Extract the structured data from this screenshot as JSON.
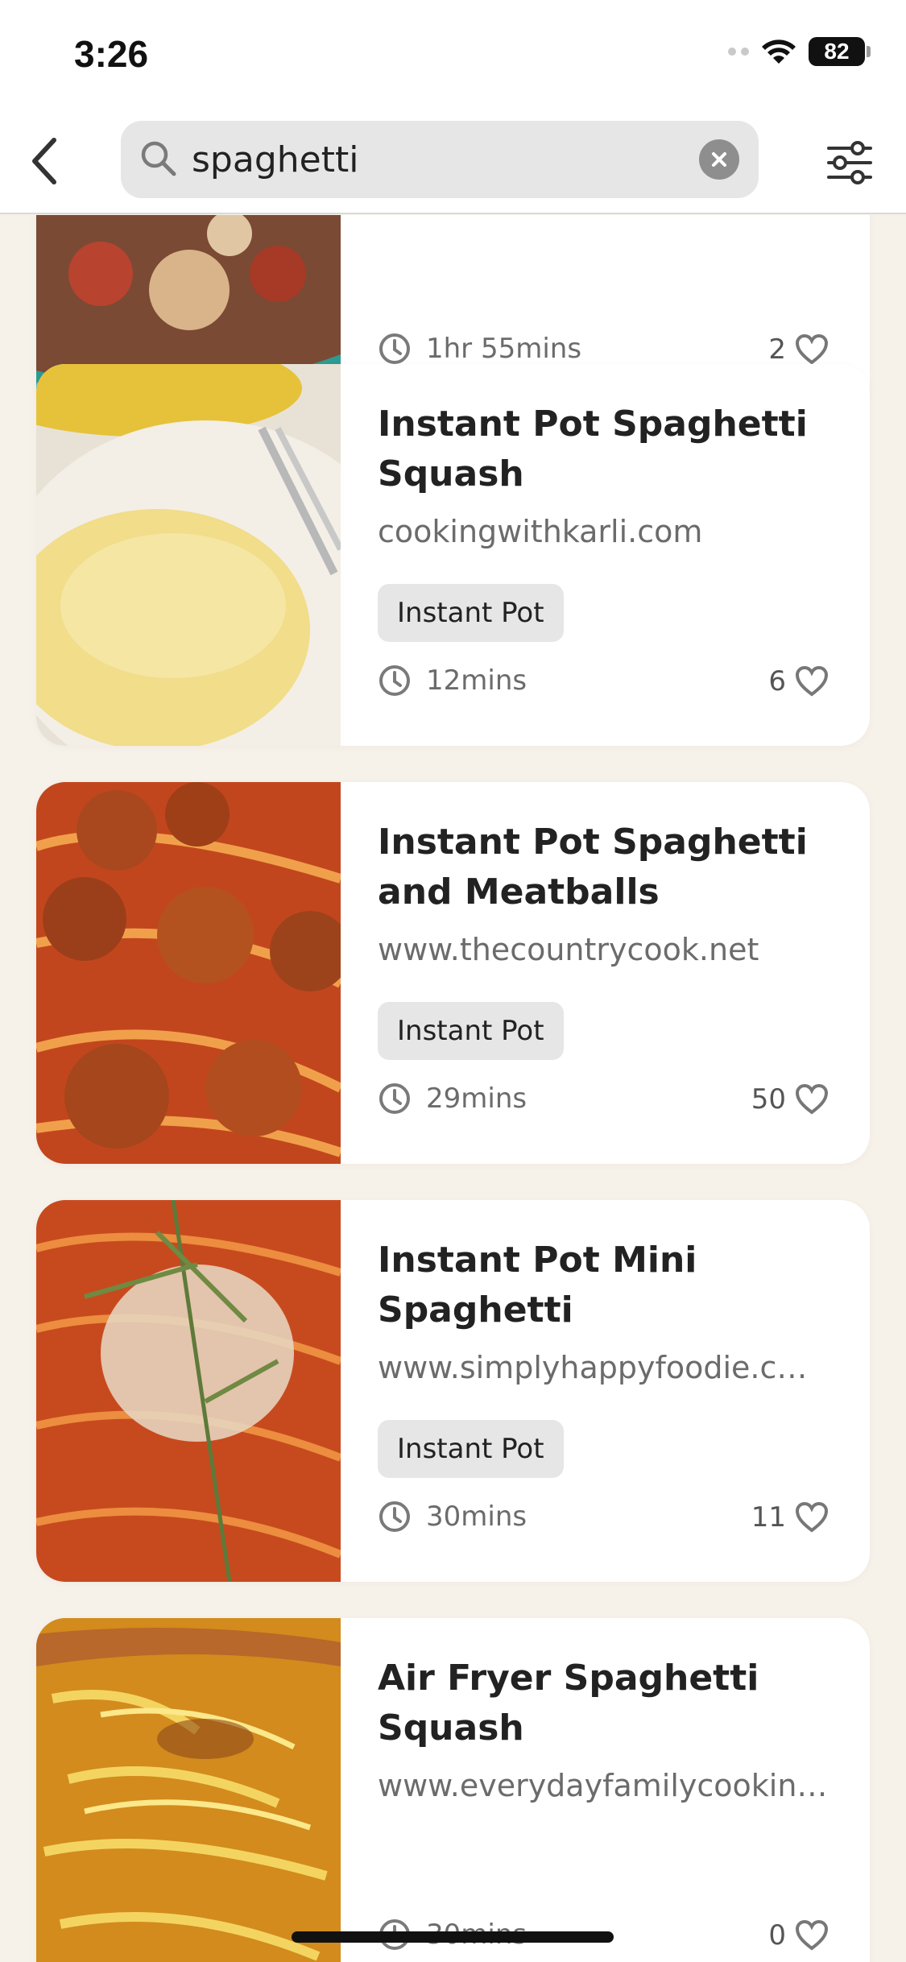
{
  "status_bar": {
    "time": "3:26",
    "battery": "82"
  },
  "search": {
    "query": "spaghetti",
    "placeholder": ""
  },
  "recipes": [
    {
      "title": "",
      "source": "",
      "time": "1hr 55mins",
      "likes": "2"
    },
    {
      "title": "Instant Pot Spaghetti Squash",
      "source": "cookingwithkarli.com",
      "tag": "Instant Pot",
      "time": "12mins",
      "likes": "6"
    },
    {
      "title": "Instant Pot Spaghetti and Meatballs",
      "source": "www.thecountrycook.net",
      "tag": "Instant Pot",
      "time": "29mins",
      "likes": "50"
    },
    {
      "title": "Instant Pot Mini Spaghetti",
      "source": "www.simplyhappyfoodie.c…",
      "tag": "Instant Pot",
      "time": "30mins",
      "likes": "11"
    },
    {
      "title": "Air Fryer Spaghetti Squash",
      "source": "www.everydayfamilycookin…",
      "time": "30mins",
      "likes": "0"
    }
  ],
  "colors": {
    "background": "#f6f1e9",
    "card": "#ffffff",
    "tag_bg": "#e6e6e6",
    "search_bg": "#e6e6e6"
  },
  "icons": {
    "back": "chevron-left-icon",
    "search": "magnifier-icon",
    "clear": "x-circle-icon",
    "filter": "sliders-icon",
    "time": "clock-icon",
    "likes": "heart-outline-icon"
  }
}
